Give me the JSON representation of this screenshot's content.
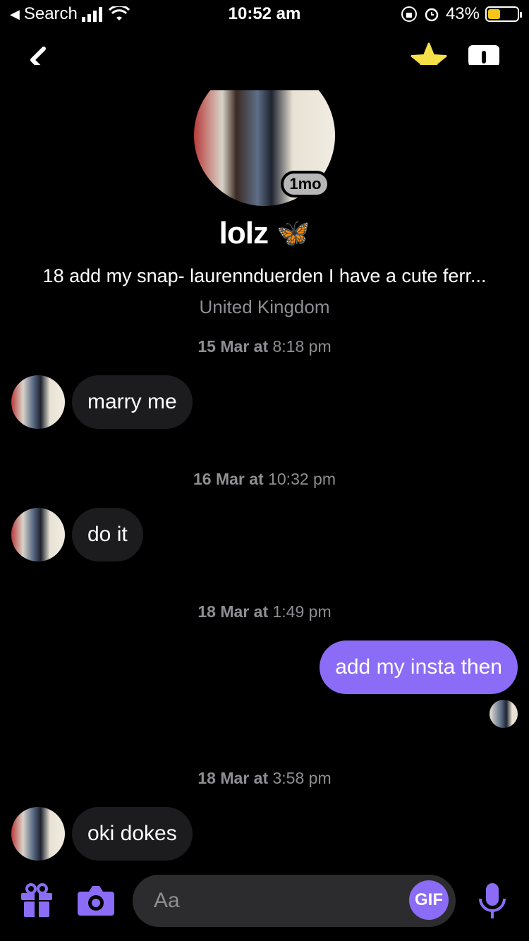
{
  "status_bar": {
    "back_label": "Search",
    "time": "10:52 am",
    "battery": "43%",
    "battery_level": 0.43,
    "battery_color": "#f5c518"
  },
  "nav": {
    "back_icon": "chevron-left-icon",
    "favorite_icon": "star-icon",
    "favorite_color": "#f5e04a",
    "report_icon": "report-shield-icon"
  },
  "profile": {
    "age_badge": "1mo",
    "name": "lolz",
    "name_emoji": "🦋",
    "bio": "18 add my snap- laurennduerden I have a cute ferr...",
    "location": "United Kingdom"
  },
  "messages": [
    {
      "date": "15 Mar at",
      "time": "8:18 pm",
      "direction": "in",
      "text": "marry me"
    },
    {
      "date": "16 Mar at",
      "time": "10:32 pm",
      "direction": "in",
      "text": "do it"
    },
    {
      "date": "18 Mar at",
      "time": "1:49 pm",
      "direction": "out",
      "text": "add my insta then"
    },
    {
      "date": "18 Mar at",
      "time": "3:58 pm",
      "direction": "in",
      "text": "oki dokes"
    }
  ],
  "composer": {
    "placeholder": "Aa",
    "gif_label": "GIF",
    "accent_color": "#8b6cf6"
  }
}
